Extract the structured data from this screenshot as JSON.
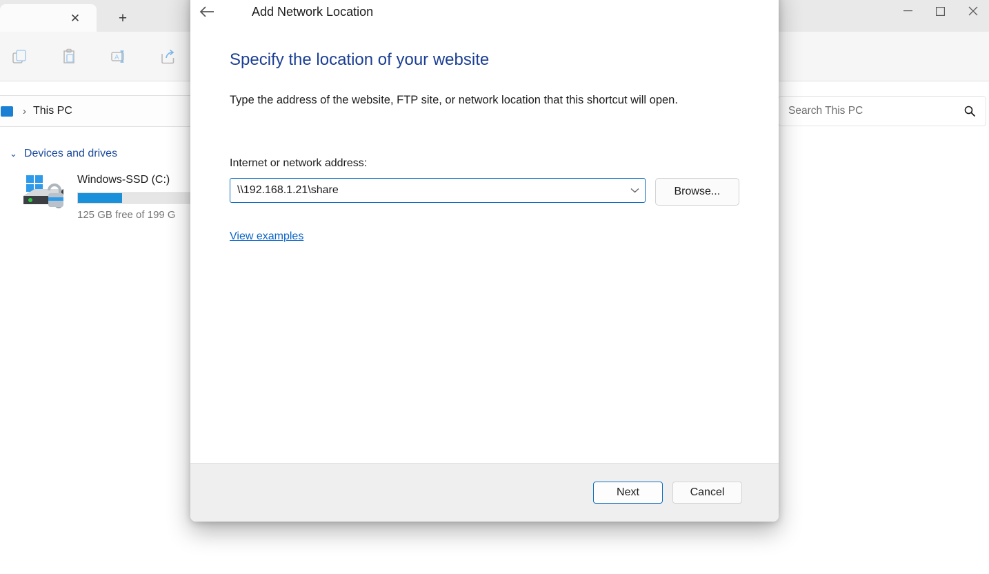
{
  "explorer": {
    "tabs": {
      "close_label": "✕",
      "new_tab_label": "+"
    },
    "window_controls": {
      "minimize": "—",
      "maximize": "☐",
      "close": "✕"
    },
    "toolbar": {
      "icons": [
        {
          "name": "copy-icon"
        },
        {
          "name": "paste-icon"
        },
        {
          "name": "rename-icon"
        },
        {
          "name": "share-icon"
        }
      ]
    },
    "address_bar": {
      "separator": "›",
      "crumb": "This PC"
    },
    "search": {
      "placeholder": "Search This PC",
      "icon": "search-icon"
    },
    "content": {
      "group_chevron": "⌄",
      "group_title": "Devices and drives",
      "drive": {
        "name": "Windows-SSD (C:)",
        "free_text": "125 GB free of 199 G",
        "used_percent": 37,
        "bar_color": "#1b90da"
      }
    }
  },
  "dialog": {
    "back_icon": "back-arrow-icon",
    "title": "Add Network Location",
    "heading": "Specify the location of your website",
    "description": "Type the address of the website, FTP site, or network location that this shortcut will open.",
    "field_label": "Internet or network address:",
    "address_value": "\\\\192.168.1.21\\share",
    "address_placeholder": "",
    "caret": "⌄",
    "browse_label": "Browse...",
    "examples_link": "View examples",
    "next_label": "Next",
    "cancel_label": "Cancel",
    "heading_color": "#1c3f94",
    "link_color": "#0a64c8",
    "accent_color": "#0d6ebf"
  }
}
